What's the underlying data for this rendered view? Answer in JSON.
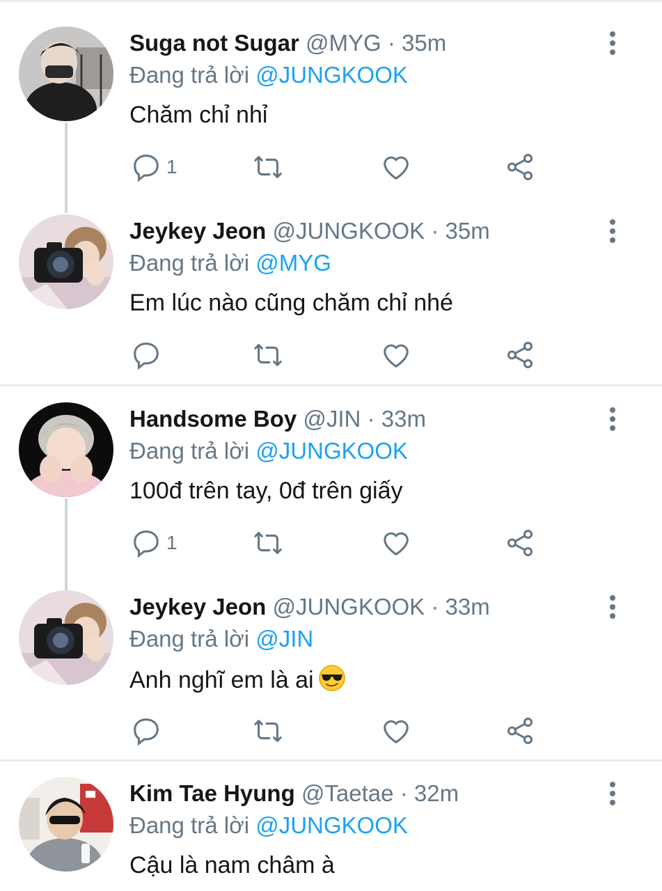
{
  "tweets": [
    {
      "name": "Suga not Sugar",
      "handle": "@MYG",
      "time": "35m",
      "reply_label": "Đang trả lời",
      "reply_to": "@JUNGKOOK",
      "text": "Chăm chỉ nhỉ",
      "reply_count": "1"
    },
    {
      "name": "Jeykey Jeon",
      "handle": "@JUNGKOOK",
      "time": "35m",
      "reply_label": "Đang trả lời",
      "reply_to": "@MYG",
      "text": "Em lúc nào cũng chăm chỉ nhé",
      "reply_count": ""
    },
    {
      "name": "Handsome Boy",
      "handle": "@JIN",
      "time": "33m",
      "reply_label": "Đang trả lời",
      "reply_to": "@JUNGKOOK",
      "text": "100đ trên tay, 0đ trên giấy",
      "reply_count": "1"
    },
    {
      "name": "Jeykey Jeon",
      "handle": "@JUNGKOOK",
      "time": "33m",
      "reply_label": "Đang trả lời",
      "reply_to": "@JIN",
      "text": "Anh nghĩ em là ai",
      "reply_count": ""
    },
    {
      "name": "Kim Tae Hyung",
      "handle": "@Taetae",
      "time": "32m",
      "reply_label": "Đang trả lời",
      "reply_to": "@JUNGKOOK",
      "text": "Cậu là nam châm à",
      "reply_count": ""
    }
  ],
  "separator": "·",
  "colors": {
    "mention": "#1da1f2",
    "muted": "#657786",
    "divider": "#e6ecf0",
    "thread": "#ccd6dd"
  },
  "icons": [
    "reply-icon",
    "retweet-icon",
    "like-icon",
    "share-icon",
    "more-icon",
    "sunglasses-emoji-icon"
  ]
}
